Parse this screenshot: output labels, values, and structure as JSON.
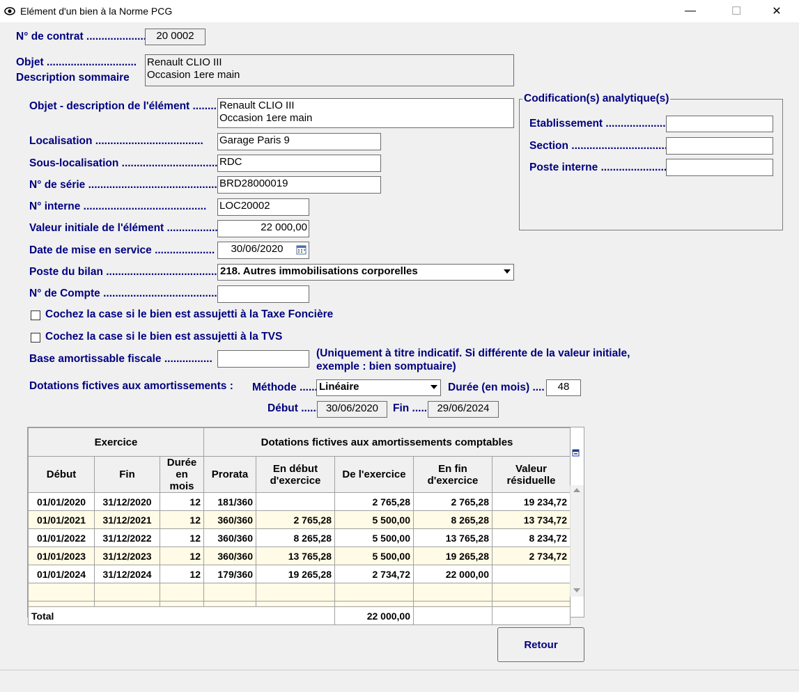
{
  "window": {
    "title": "Elément d'un bien à la Norme PCG",
    "minimize": "—",
    "maximize": "☐",
    "close": "✕"
  },
  "contrat": {
    "label": "N° de contrat ....................",
    "value": "20 0002"
  },
  "objet": {
    "label1": "Objet ..............................",
    "label2": "Description sommaire",
    "value": "Renault CLIO III\nOccasion 1ere main"
  },
  "element": {
    "desc_label": "Objet - description de l'élément ........",
    "desc_value": "Renault CLIO III\nOccasion 1ere main",
    "localisation_label": "Localisation ....................................",
    "localisation_value": "Garage Paris 9",
    "sous_loc_label": "Sous-localisation ..................................",
    "sous_loc_value": "RDC",
    "serie_label": "N° de série ..............................................",
    "serie_value": "BRD28000019",
    "interne_label": "N° interne .........................................",
    "interne_value": "LOC20002",
    "valeur_label": "Valeur initiale de l'élément .................",
    "valeur_value": "22 000,00",
    "date_label": "Date de mise en service ....................",
    "date_value": "30/06/2020",
    "bilan_label": "Poste du bilan ...................................................",
    "bilan_value": "218. Autres immobilisations corporelles",
    "compte_label": "N° de Compte ............................................",
    "compte_value": "",
    "taxe_fonciere_label": "Cochez la case si le bien est assujetti à la Taxe Foncière",
    "tvs_label": "Cochez la case si le bien est assujetti à la TVS",
    "base_label": "Base amortissable fiscale ................",
    "base_value": "",
    "base_note1": "(Uniquement à titre indicatif. Si différente de la valeur initiale,",
    "base_note2": "exemple : bien somptuaire)"
  },
  "codification": {
    "title": "Codification(s) analytique(s)",
    "etab_label": "Etablissement ......................",
    "section_label": "Section ........................................",
    "poste_label": "Poste interne ........................"
  },
  "dotations": {
    "label": "Dotations fictives aux amortissements :",
    "methode_label": "Méthode ......",
    "methode_value": "Linéaire",
    "duree_label": "Durée (en mois) ....",
    "duree_value": "48",
    "debut_label": "Début ......",
    "debut_value": "30/06/2020",
    "fin_label": "Fin .......",
    "fin_value": "29/06/2024"
  },
  "grid": {
    "group_exercice": "Exercice",
    "group_dotations": "Dotations fictives aux amortissements comptables",
    "columns": [
      "Début",
      "Fin",
      "Durée\nen mois",
      "Prorata",
      "En début\nd'exercice",
      "De l'exercice",
      "En fin\nd'exercice",
      "Valeur\nrésiduelle"
    ],
    "rows": [
      [
        "01/01/2020",
        "31/12/2020",
        "12",
        "181/360",
        "",
        "2 765,28",
        "2 765,28",
        "19 234,72"
      ],
      [
        "01/01/2021",
        "31/12/2021",
        "12",
        "360/360",
        "2 765,28",
        "5 500,00",
        "8 265,28",
        "13 734,72"
      ],
      [
        "01/01/2022",
        "31/12/2022",
        "12",
        "360/360",
        "8 265,28",
        "5 500,00",
        "13 765,28",
        "8 234,72"
      ],
      [
        "01/01/2023",
        "31/12/2023",
        "12",
        "360/360",
        "13 765,28",
        "5 500,00",
        "19 265,28",
        "2 734,72"
      ],
      [
        "01/01/2024",
        "31/12/2024",
        "12",
        "179/360",
        "19 265,28",
        "2 734,72",
        "22 000,00",
        ""
      ]
    ],
    "total_label": "Total",
    "total_value": "22 000,00"
  },
  "buttons": {
    "retour": "Retour"
  },
  "colors": {
    "label": "#00007f",
    "row_alt": "#fffbe6"
  }
}
